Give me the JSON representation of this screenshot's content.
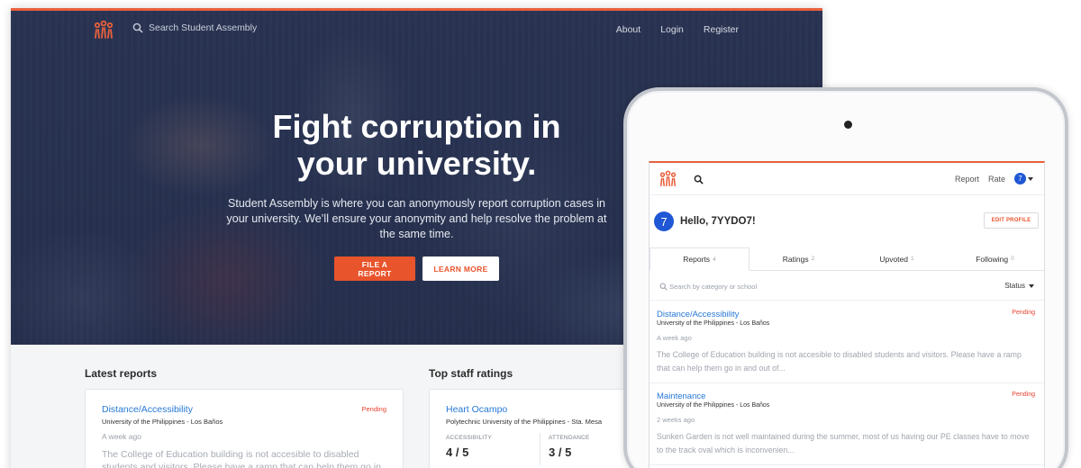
{
  "desktop": {
    "nav": {
      "search_text": "Search Student Assembly",
      "links": [
        "About",
        "Login",
        "Register"
      ]
    },
    "hero": {
      "title_line1": "Fight corruption in",
      "title_line2": "your university.",
      "subtitle": "Student Assembly is where you can anonymously report corruption cases in your university. We’ll ensure your anonymity and help resolve the problem at the same time.",
      "primary_button": "FILE A REPORT",
      "secondary_button": "LEARN MORE"
    },
    "latest_reports": {
      "title": "Latest reports",
      "card": {
        "category": "Distance/Accessibility",
        "school": "University of the Philippines - Los Baños",
        "time": "A week ago",
        "status": "Pending",
        "description": "The College of Education building is not accesible to disabled students and visitors. Please have a ramp that can help them go in"
      }
    },
    "top_staff": {
      "title": "Top staff ratings",
      "card": {
        "name": "Heart Ocampo",
        "school": "Polytechnic University of the Philippines - Sta. Mesa",
        "metrics": [
          {
            "label": "ACCESSIBILITY",
            "value": "4 / 5"
          },
          {
            "label": "ATTENDANCE",
            "value": "3 / 5"
          }
        ]
      }
    }
  },
  "tablet": {
    "nav": {
      "links": [
        "Report",
        "Rate"
      ],
      "avatar": "7"
    },
    "greeting": {
      "avatar": "7",
      "text": "Hello, 7YYDO7!",
      "edit_button": "EDIT PROFILE"
    },
    "tabs": [
      {
        "label": "Reports",
        "count": "4"
      },
      {
        "label": "Ratings",
        "count": "2"
      },
      {
        "label": "Upvoted",
        "count": "1"
      },
      {
        "label": "Following",
        "count": "0"
      }
    ],
    "filter": {
      "placeholder": "Search by category or school",
      "status": "Status"
    },
    "reports": [
      {
        "category": "Distance/Accessibility",
        "school": "University of the Philippines - Los Baños",
        "time": "A week ago",
        "status": "Pending",
        "description": "The College of Education building is not accesible to disabled students and visitors. Please have a ramp that can help them go in and out of..."
      },
      {
        "category": "Maintenance",
        "school": "University of the Philippines - Los Baños",
        "time": "2 weeks ago",
        "status": "Pending",
        "description": "Sunken Garden is not well maintained during the summer, most of us having our PE classes have to move to the track oval which is inconvenien..."
      }
    ]
  },
  "colors": {
    "accent": "#e8542c",
    "link": "#2778d6",
    "pending": "#e5412e",
    "avatar": "#1f57d4",
    "hero_overlay": "#2c3856"
  }
}
